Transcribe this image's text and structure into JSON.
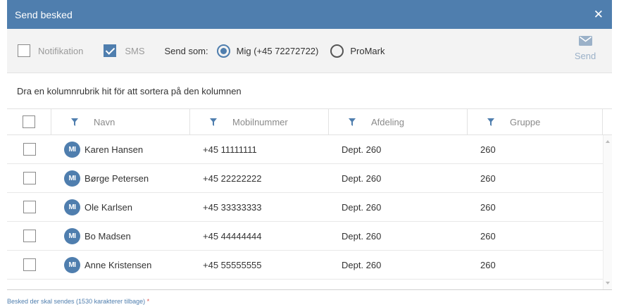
{
  "titlebar": {
    "title": "Send besked",
    "close_glyph": "✕"
  },
  "toolbar": {
    "notification": {
      "label": "Notifikation",
      "checked": false
    },
    "sms": {
      "label": "SMS",
      "checked": true
    },
    "send_as_label": "Send som:",
    "send_as_options": [
      {
        "label": "Mig (+45 72272722)",
        "selected": true
      },
      {
        "label": "ProMark",
        "selected": false
      }
    ],
    "send_button": {
      "label": "Send",
      "icon": "envelope-icon"
    }
  },
  "grouping_hint": "Dra en kolumnrubrik hit för att sortera på den kolumnen",
  "grid": {
    "columns": [
      "Navn",
      "Mobilnummer",
      "Afdeling",
      "Gruppe"
    ],
    "rows": [
      {
        "initials": "MI",
        "name": "Karen Hansen",
        "mobile": "+45 11111111",
        "department": "Dept. 260",
        "group": "260"
      },
      {
        "initials": "MI",
        "name": "Børge Petersen",
        "mobile": "+45 22222222",
        "department": "Dept. 260",
        "group": "260"
      },
      {
        "initials": "MI",
        "name": "Ole Karlsen",
        "mobile": "+45 33333333",
        "department": "Dept. 260",
        "group": "260"
      },
      {
        "initials": "MI",
        "name": "Bo Madsen",
        "mobile": "+45 44444444",
        "department": "Dept. 260",
        "group": "260"
      },
      {
        "initials": "MI",
        "name": "Anne Kristensen",
        "mobile": "+45 55555555",
        "department": "Dept. 260",
        "group": "260"
      }
    ]
  },
  "message_field": {
    "label": "Besked der skal sendes (1530 karakterer tilbage)",
    "required_mark": "*"
  },
  "colors": {
    "accent": "#4f7eae",
    "toolbar_bg": "#f3f3f3",
    "required": "#d9534f"
  }
}
